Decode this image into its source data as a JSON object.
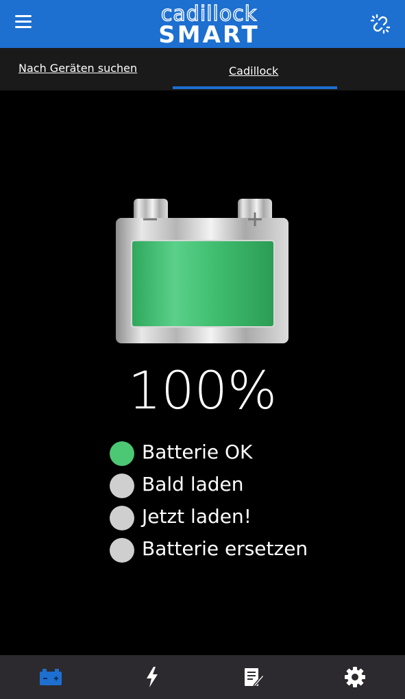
{
  "header": {
    "logo_top": "cadillock",
    "logo_bottom": "SMART"
  },
  "tabs": [
    {
      "label": "Nach Geräten suchen",
      "active": false
    },
    {
      "label": "Cadillock",
      "active": true
    }
  ],
  "battery": {
    "charge_fraction": 1.0,
    "percent_label": "100%"
  },
  "status": [
    {
      "label": "Batterie OK",
      "active": true,
      "color": "#4cc774"
    },
    {
      "label": "Bald laden",
      "active": false,
      "color": "#cfcfcf"
    },
    {
      "label": "Jetzt laden!",
      "active": false,
      "color": "#cfcfcf"
    },
    {
      "label": "Batterie ersetzen",
      "active": false,
      "color": "#cfcfcf"
    }
  ],
  "bottom_nav": [
    {
      "icon": "battery-icon",
      "active": true
    },
    {
      "icon": "lightning-icon",
      "active": false
    },
    {
      "icon": "notes-icon",
      "active": false
    },
    {
      "icon": "gear-icon",
      "active": false
    }
  ],
  "colors": {
    "brand_blue": "#1d6fd0",
    "ok_green": "#4cc774",
    "inactive_gray": "#cfcfcf"
  }
}
